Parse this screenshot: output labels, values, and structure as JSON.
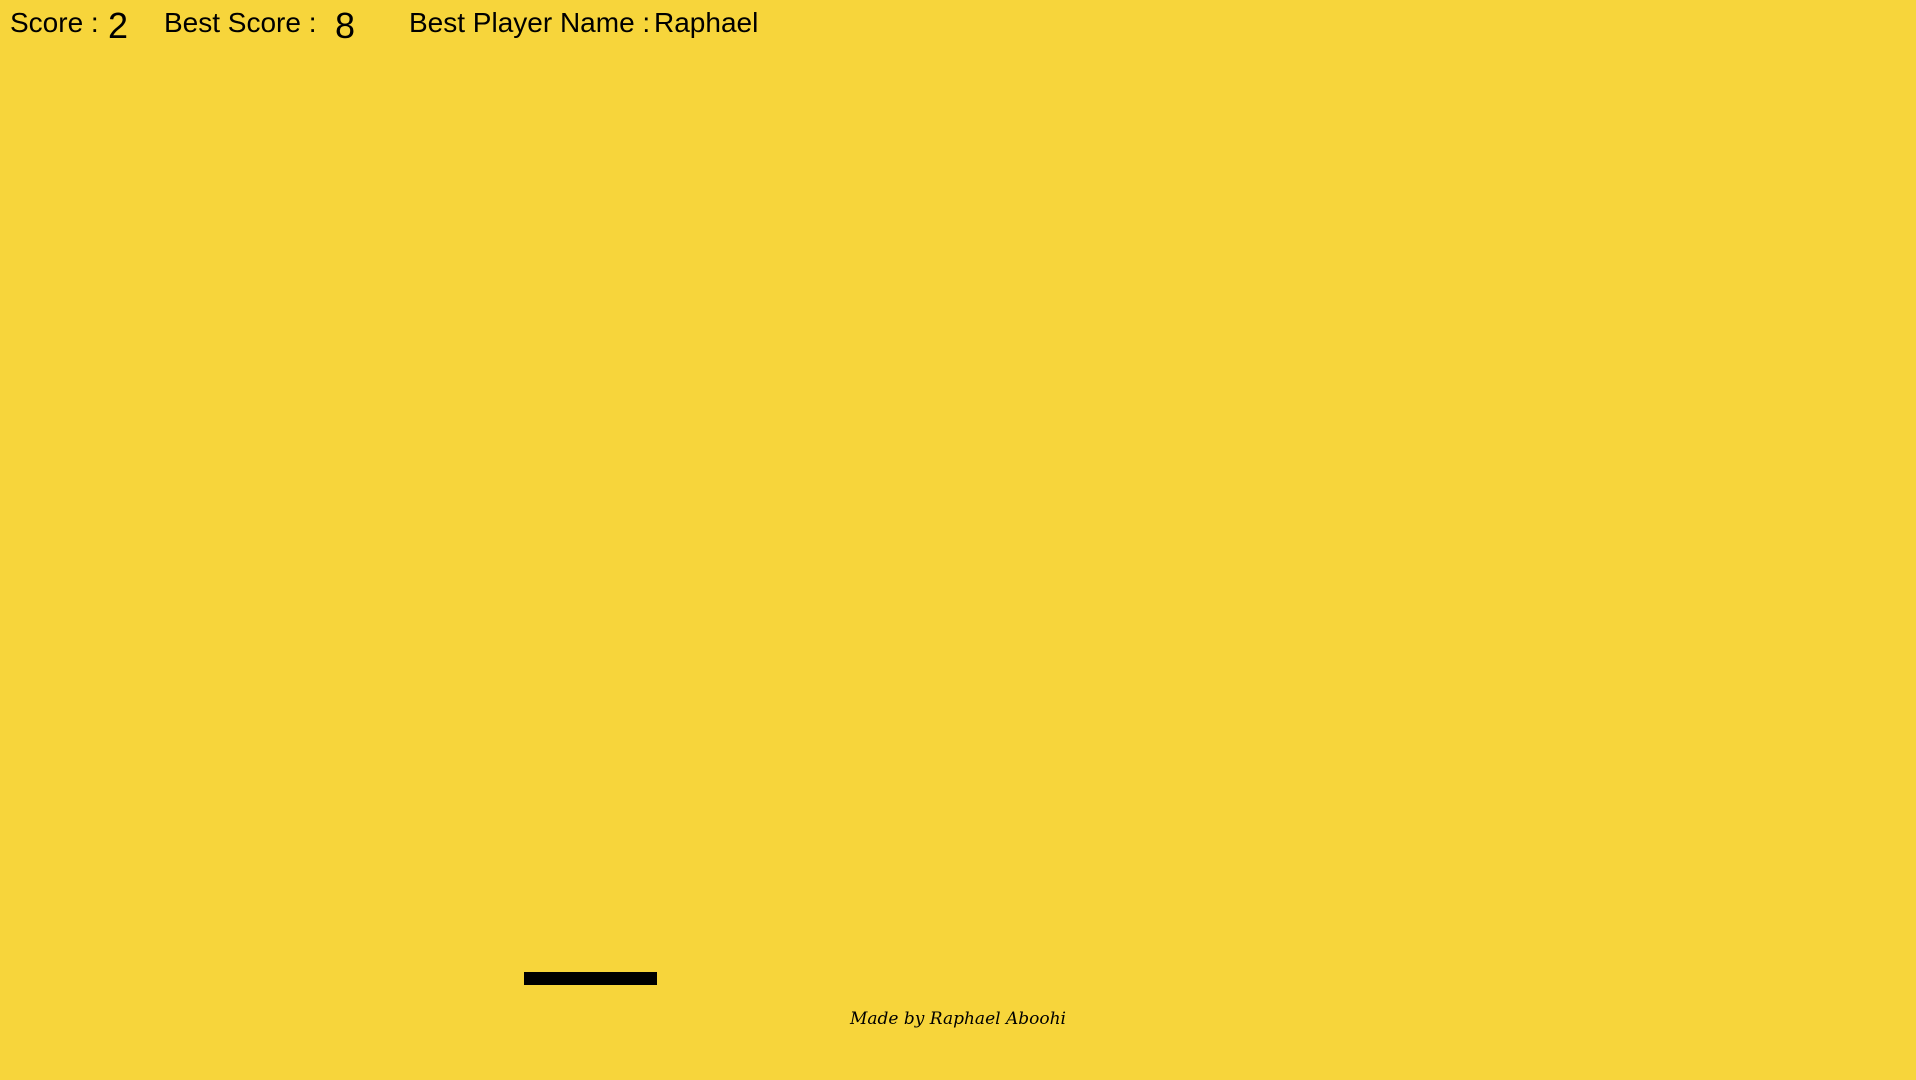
{
  "hud": {
    "score_label": "Score :",
    "score_value": "2",
    "best_score_label": "Best Score :",
    "best_score_value": "8",
    "best_player_label": "Best Player Name :",
    "best_player_value": "Raphael"
  },
  "footer": {
    "credit": "Made by Raphael Aboohi"
  },
  "colors": {
    "background": "#F7D53B",
    "paddle": "#000000"
  }
}
